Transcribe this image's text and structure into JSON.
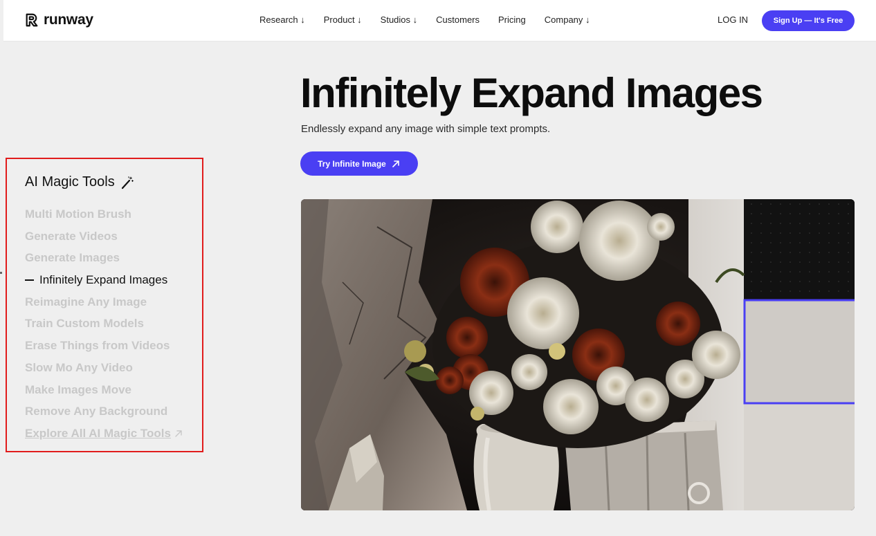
{
  "header": {
    "logo_text": "runway",
    "nav": [
      {
        "label": "Research ↓"
      },
      {
        "label": "Product ↓"
      },
      {
        "label": "Studios ↓"
      },
      {
        "label": "Customers"
      },
      {
        "label": "Pricing"
      },
      {
        "label": "Company ↓"
      }
    ],
    "login_label": "LOG IN",
    "signup_label": "Sign Up — It's Free"
  },
  "hero": {
    "title": "Infinitely Expand Images",
    "subtitle": "Endlessly expand any image with simple text prompts.",
    "cta_label": "Try Infinite Image",
    "cta_icon": "arrow-up-right-icon"
  },
  "sidebar": {
    "title": "AI Magic Tools",
    "title_icon": "magic-wand-icon",
    "tools": [
      {
        "label": "Multi Motion Brush",
        "active": false
      },
      {
        "label": "Generate Videos",
        "active": false
      },
      {
        "label": "Generate Images",
        "active": false
      },
      {
        "label": "Infinitely Expand Images",
        "active": true
      },
      {
        "label": "Reimagine Any Image",
        "active": false
      },
      {
        "label": "Train Custom Models",
        "active": false
      },
      {
        "label": "Erase Things from Videos",
        "active": false
      },
      {
        "label": "Slow Mo Any Video",
        "active": false
      },
      {
        "label": "Make Images Move",
        "active": false
      },
      {
        "label": "Remove Any Background",
        "active": false
      }
    ],
    "explore_label": "Explore All AI Magic Tools",
    "explore_icon": "arrow-up-right-icon"
  },
  "colors": {
    "accent": "#4a3ff3",
    "highlight_border": "#e11b1b",
    "page_bg": "#efefef",
    "inactive_text": "#c8c8c8"
  }
}
